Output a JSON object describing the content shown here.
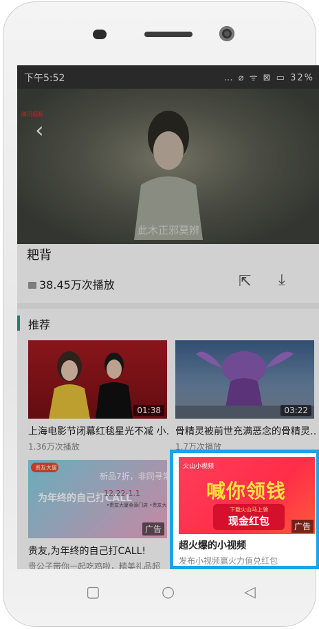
{
  "status": {
    "time": "下午5:52",
    "icons": "… ⌀ ᯤ ⊠ ▭ 32%"
  },
  "player": {
    "subtitle": "此木正邪莫辨",
    "channel": "腾讯视频"
  },
  "video": {
    "title_partial": "耙背",
    "play_count": "38.45万次播放"
  },
  "section": {
    "title": "推荐"
  },
  "cards": [
    {
      "title": "上海电影节闭幕红毯星光不减 小…",
      "meta": "1.36万次播放",
      "duration": "01:38"
    },
    {
      "title": "骨精灵被前世充满恶念的骨精灵…",
      "meta": "1.7万次播放",
      "duration": "03:22"
    },
    {
      "title": "贵友,为年终的自己打CALL!",
      "meta": "贵公子带你一起吃鸡啦，精美礼品超",
      "ad_tag": "广告",
      "ad_text": {
        "brand": "贵友大厦",
        "promo": "新品7折，非同寻常",
        "dates": "12.22-1.1",
        "branches": "•贵友大厦金源门店\n•贵友大厦金源店\n•贵友大厦通州店",
        "slogan": "为年终的自己打CALL"
      }
    },
    {
      "title": "超火爆的小视频",
      "meta": "发布小视频赢火力值兑红包",
      "ad_tag": "广告",
      "ad_text": {
        "brand": "火山小视频",
        "headline": "喊你领钱",
        "sub": "下载火山马上领",
        "cta": "现金红包"
      }
    }
  ],
  "colors": {
    "accent": "#1fa37c",
    "highlight": "#1aa3e6",
    "ad_red": "#ff2d48"
  },
  "nav": {
    "recent": "▢",
    "home": "○",
    "back": "◁"
  }
}
